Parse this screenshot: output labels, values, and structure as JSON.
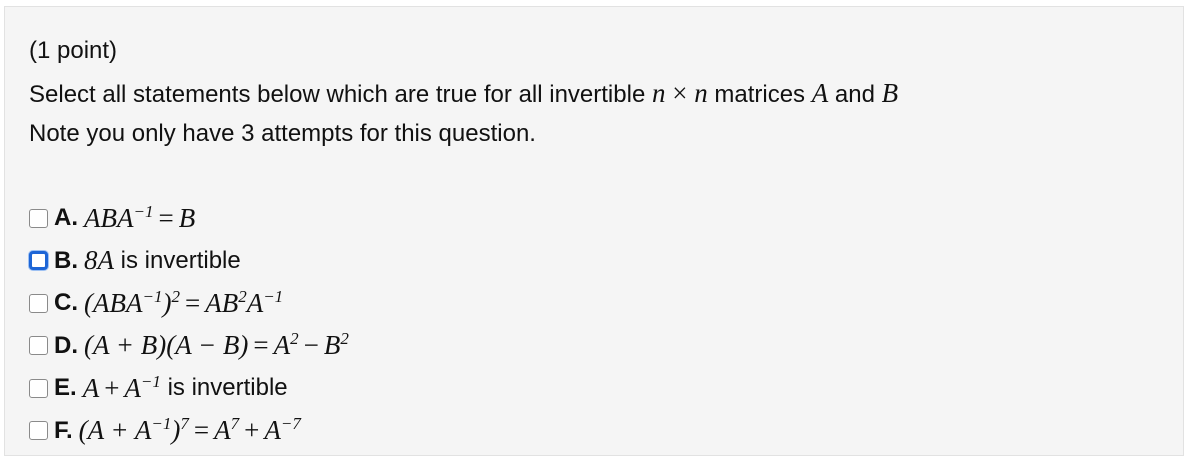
{
  "question": {
    "points_label": "(1 point)",
    "prompt_before": "Select all statements below which are true for all invertible ",
    "prompt_math_n1": "n",
    "prompt_math_times": "×",
    "prompt_math_n2": "n",
    "prompt_mid": " matrices ",
    "prompt_math_A": "A",
    "prompt_and": " and ",
    "prompt_math_B": "B",
    "note": "Note you only have 3 attempts for this question."
  },
  "options": [
    {
      "letter": "A.",
      "checked": false,
      "focused": false
    },
    {
      "letter": "B.",
      "checked": false,
      "focused": true,
      "text": " is invertible"
    },
    {
      "letter": "C.",
      "checked": false,
      "focused": false
    },
    {
      "letter": "D.",
      "checked": false,
      "focused": false
    },
    {
      "letter": "E.",
      "checked": false,
      "focused": false,
      "text": " is invertible"
    },
    {
      "letter": "F.",
      "checked": false,
      "focused": false
    }
  ],
  "math": {
    "a": {
      "lhs": "ABA",
      "exp": "−1",
      "eq": "=",
      "rhs": "B"
    },
    "b": {
      "expr": "8A"
    },
    "c": {
      "open": "(ABA",
      "exp1": "−1",
      "close": ")",
      "exp2": "2",
      "eq": "=",
      "rhs1": "AB",
      "exp3": "2",
      "rhs2": "A",
      "exp4": "−1"
    },
    "d": {
      "lhs": "(A + B)(A − B)",
      "eq": "=",
      "r1": "A",
      "e1": "2",
      "minus": "−",
      "r2": "B",
      "e2": "2"
    },
    "e": {
      "t1": "A",
      "plus": "+",
      "t2": "A",
      "exp": "−1"
    },
    "f": {
      "open": "(A + A",
      "e1": "−1",
      "close": ")",
      "e2": "7",
      "eq": "=",
      "r1": "A",
      "e3": "7",
      "plus": "+",
      "r2": "A",
      "e4": "−7"
    }
  }
}
